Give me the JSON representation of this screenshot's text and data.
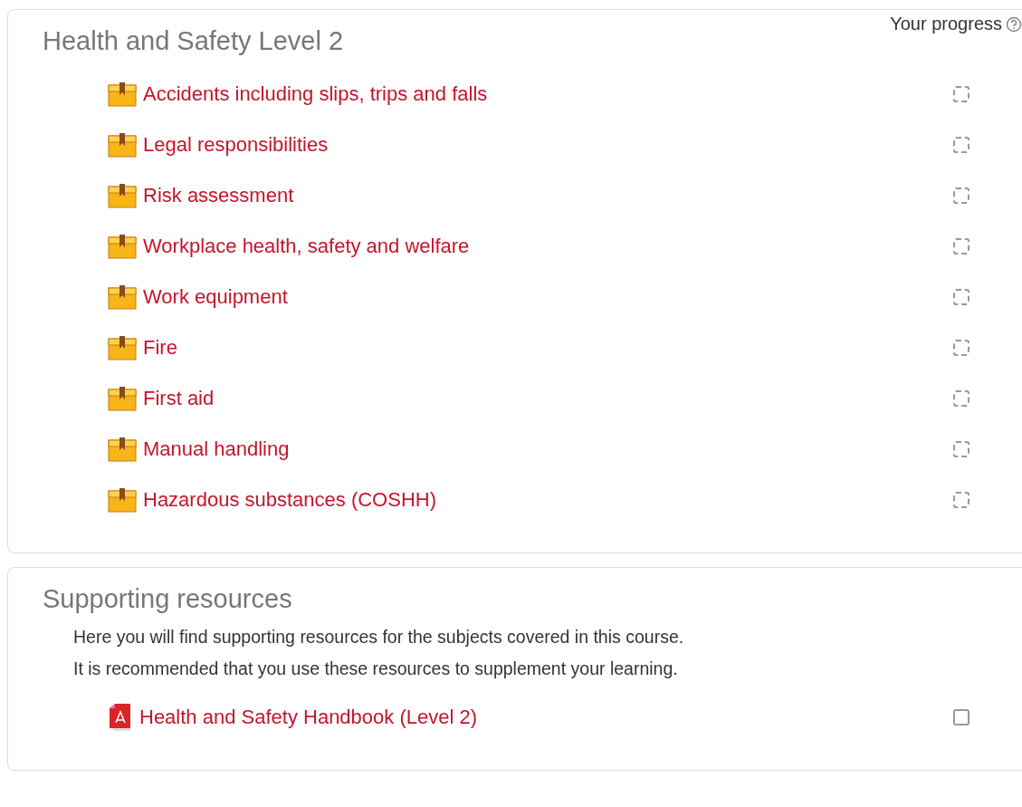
{
  "sections": [
    {
      "title": "Health and Safety Level 2",
      "progress_label": "Your progress",
      "activities": [
        {
          "kind": "package",
          "label": "Accidents including slips, trips and falls",
          "completion": {
            "kind": "auto",
            "checked": false
          }
        },
        {
          "kind": "package",
          "label": "Legal responsibilities",
          "completion": {
            "kind": "auto",
            "checked": false
          }
        },
        {
          "kind": "package",
          "label": "Risk assessment",
          "completion": {
            "kind": "auto",
            "checked": false
          }
        },
        {
          "kind": "package",
          "label": "Workplace health, safety and welfare",
          "completion": {
            "kind": "auto",
            "checked": false
          }
        },
        {
          "kind": "package",
          "label": "Work equipment",
          "completion": {
            "kind": "auto",
            "checked": false
          }
        },
        {
          "kind": "package",
          "label": "Fire",
          "completion": {
            "kind": "auto",
            "checked": false
          }
        },
        {
          "kind": "package",
          "label": "First aid",
          "completion": {
            "kind": "auto",
            "checked": false
          }
        },
        {
          "kind": "package",
          "label": "Manual handling",
          "completion": {
            "kind": "auto",
            "checked": false
          }
        },
        {
          "kind": "package",
          "label": "Hazardous substances (COSHH)",
          "completion": {
            "kind": "auto",
            "checked": false
          }
        }
      ]
    },
    {
      "title": "Supporting resources",
      "summary": [
        "Here you will find supporting resources for the subjects covered in this course.",
        "It is recommended that you use these resources to supplement your learning."
      ],
      "activities": [
        {
          "kind": "pdf",
          "label": "Health and Safety Handbook (Level 2)",
          "completion": {
            "kind": "manual",
            "checked": false
          }
        }
      ]
    }
  ]
}
